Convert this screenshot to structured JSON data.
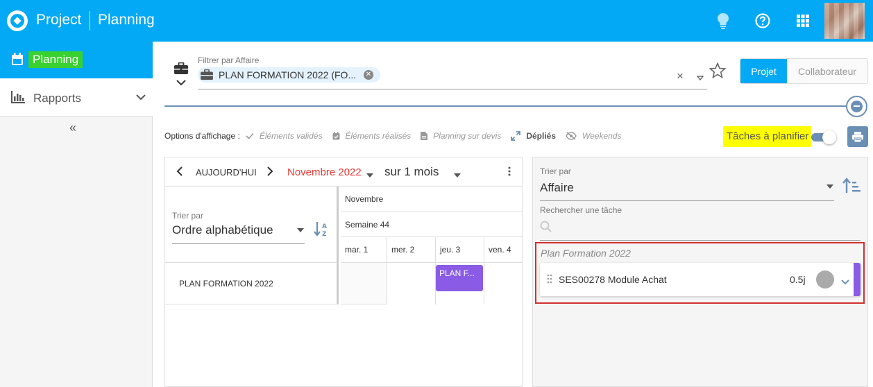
{
  "app": {
    "name": "Project",
    "module": "Planning"
  },
  "sidebar": {
    "items": [
      {
        "label": "Planning",
        "icon": "calendar-icon",
        "active": true
      },
      {
        "label": "Rapports",
        "icon": "bar-chart-icon",
        "active": false
      }
    ],
    "collapse_label": "«"
  },
  "filter": {
    "label": "Filtrer par Affaire",
    "chip": "PLAN FORMATION 2022 (FO...",
    "clear": "×"
  },
  "view_toggle": {
    "projet": "Projet",
    "collaborateur": "Collaborateur",
    "selected": "Projet"
  },
  "options": {
    "title": "Options d'affichage :",
    "items": [
      {
        "label": "Éléments validés",
        "icon": "check-icon",
        "active": false
      },
      {
        "label": "Éléments réalisés",
        "icon": "calendar-check-icon",
        "active": false
      },
      {
        "label": "Planning sur devis",
        "icon": "document-icon",
        "active": false
      },
      {
        "label": "Dépliés",
        "icon": "expand-icon",
        "active": true
      },
      {
        "label": "Weekends",
        "icon": "eye-slash-icon",
        "active": false
      }
    ],
    "taches": "Tâches à planifier",
    "taches_enabled": true
  },
  "calendar": {
    "today": "AUJOURD'HUI",
    "month": "Novembre 2022",
    "range": "sur 1 mois",
    "sort_label": "Trier par",
    "sort_value": "Ordre alphabétique",
    "header_month": "Novembre",
    "header_week": "Semaine 44",
    "days": [
      "mar. 1",
      "mer. 2",
      "jeu. 3",
      "ven. 4"
    ],
    "rows": [
      {
        "label": "PLAN FORMATION 2022"
      }
    ],
    "event": {
      "label": "PLAN F...",
      "color": "#8a5ce6"
    }
  },
  "tasks_panel": {
    "sort_label": "Trier par",
    "sort_value": "Affaire",
    "search_label": "Rechercher une tâche",
    "group": "Plan Formation 2022",
    "task": {
      "name": "SES00278 Module Achat",
      "duration": "0.5j"
    }
  },
  "colors": {
    "primary": "#03a9f4",
    "accent": "#6a8fb5",
    "event": "#8a5ce6",
    "highlight": "#ffff00",
    "sidebar_highlight": "#39d12f"
  }
}
